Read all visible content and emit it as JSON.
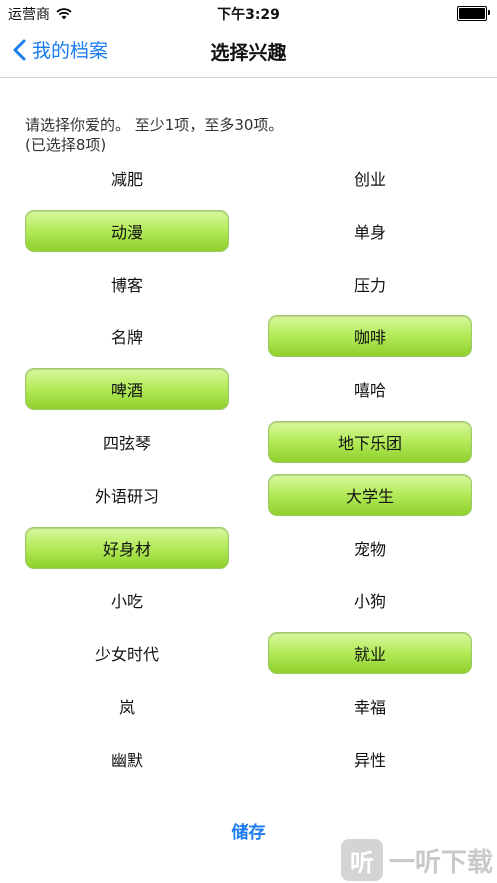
{
  "status": {
    "carrier": "运营商",
    "time": "下午3:29"
  },
  "nav": {
    "back_label": "我的档案",
    "title": "选择兴趣"
  },
  "hint": {
    "line1": "请选择你爱的。 至少1项，至多30项。",
    "line2": "(已选择8项)"
  },
  "interests": [
    {
      "label": "减肥",
      "selected": false
    },
    {
      "label": "创业",
      "selected": false
    },
    {
      "label": "动漫",
      "selected": true
    },
    {
      "label": "单身",
      "selected": false
    },
    {
      "label": "博客",
      "selected": false
    },
    {
      "label": "压力",
      "selected": false
    },
    {
      "label": "名牌",
      "selected": false
    },
    {
      "label": "咖啡",
      "selected": true
    },
    {
      "label": "啤酒",
      "selected": true
    },
    {
      "label": "嘻哈",
      "selected": false
    },
    {
      "label": "四弦琴",
      "selected": false
    },
    {
      "label": "地下乐团",
      "selected": true
    },
    {
      "label": "外语研习",
      "selected": false
    },
    {
      "label": "大学生",
      "selected": true
    },
    {
      "label": "好身材",
      "selected": true
    },
    {
      "label": "宠物",
      "selected": false
    },
    {
      "label": "小吃",
      "selected": false
    },
    {
      "label": "小狗",
      "selected": false
    },
    {
      "label": "少女时代",
      "selected": false
    },
    {
      "label": "就业",
      "selected": true
    },
    {
      "label": "岚",
      "selected": false
    },
    {
      "label": "幸福",
      "selected": false
    },
    {
      "label": "幽默",
      "selected": false
    },
    {
      "label": "异性",
      "selected": false
    }
  ],
  "save_label": "储存",
  "watermark": {
    "text": "一听下载",
    "icon_glyph": "听"
  },
  "colors": {
    "accent": "#1a7cf0",
    "selected_top": "#d8f79e",
    "selected_bottom": "#8fd12b"
  }
}
